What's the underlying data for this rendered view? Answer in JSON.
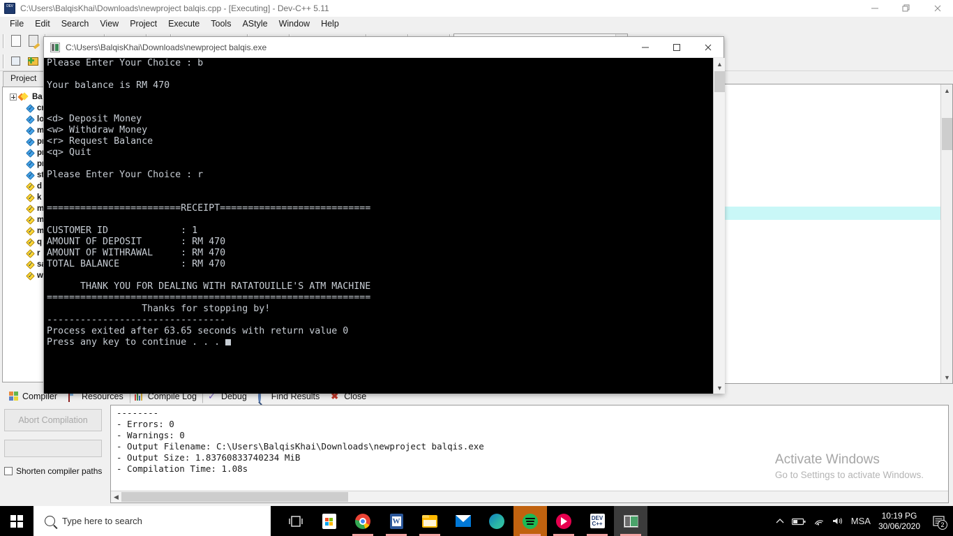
{
  "ide": {
    "title": "C:\\Users\\BalqisKhai\\Downloads\\newproject balqis.cpp - [Executing] - Dev-C++ 5.11",
    "icon": "devcpp-icon",
    "window_buttons": {
      "minimize": "–",
      "restore": "❐",
      "close": "✕"
    },
    "menu": [
      "File",
      "Edit",
      "Search",
      "View",
      "Project",
      "Execute",
      "Tools",
      "AStyle",
      "Window",
      "Help"
    ]
  },
  "project_panel": {
    "tab_label": "Project",
    "root": {
      "label": "Ba"
    },
    "items": [
      {
        "label": "cr"
      },
      {
        "label": "lo"
      },
      {
        "label": "m"
      },
      {
        "label": "pr"
      },
      {
        "label": "pr"
      },
      {
        "label": "pr"
      },
      {
        "label": "st"
      },
      {
        "label": "d"
      },
      {
        "label": "k"
      },
      {
        "label": "m"
      },
      {
        "label": "m"
      },
      {
        "label": "m"
      },
      {
        "label": "q"
      },
      {
        "label": "r"
      },
      {
        "label": "sa"
      },
      {
        "label": "w"
      }
    ]
  },
  "console": {
    "title": "C:\\Users\\BalqisKhai\\Downloads\\newproject balqis.exe",
    "icon": "console-icon",
    "window_buttons": {
      "minimize": "–",
      "maximize": "□",
      "close": "✕"
    },
    "output": "Please Enter Your Choice : b\n\nYour balance is RM 470\n\n\n<d> Deposit Money\n<w> Withdraw Money\n<r> Request Balance\n<q> Quit\n\nPlease Enter Your Choice : r\n\n\n========================RECEIPT===========================\n\nCUSTOMER ID             : 1\nAMOUNT OF DEPOSIT       : RM 470\nAMOUNT OF WITHRAWAL     : RM 470\nTOTAL BALANCE           : RM 470\n\n      THANK YOU FOR DEALING WITH RATATOUILLE'S ATM MACHINE\n==========================================================\n                 Thanks for stopping by!\n--------------------------------\nProcess exited after 63.65 seconds with return value 0\nPress any key to continue . . . ",
    "background": "#000000",
    "foreground": "#c7cdd4"
  },
  "bottom_panel": {
    "tabs": [
      {
        "label": "Compiler",
        "icon": "compiler-icon",
        "active": false
      },
      {
        "label": "Resources",
        "icon": "resources-icon",
        "active": false
      },
      {
        "label": "Compile Log",
        "icon": "compile-log-icon",
        "active": true
      },
      {
        "label": "Debug",
        "icon": "debug-icon",
        "active": false
      },
      {
        "label": "Find Results",
        "icon": "find-results-icon",
        "active": false
      },
      {
        "label": "Close",
        "icon": "close-icon",
        "active": false
      }
    ],
    "abort_button": "Abort Compilation",
    "shorten_paths_label": "Shorten compiler paths",
    "log": "--------\n- Errors: 0\n- Warnings: 0\n- Output Filename: C:\\Users\\BalqisKhai\\Downloads\\newproject balqis.exe\n- Output Size: 1.83760833740234 MiB\n- Compilation Time: 1.08s"
  },
  "watermark": {
    "title": "Activate Windows",
    "subtitle": "Go to Settings to activate Windows."
  },
  "taskbar": {
    "start_icon": "windows-start-icon",
    "search_placeholder": "Type here to search",
    "apps": [
      {
        "name": "task-view-icon"
      },
      {
        "name": "microsoft-store-icon"
      },
      {
        "name": "google-chrome-icon"
      },
      {
        "name": "microsoft-word-icon"
      },
      {
        "name": "file-explorer-icon"
      },
      {
        "name": "mail-icon"
      },
      {
        "name": "microsoft-edge-icon"
      },
      {
        "name": "spotify-icon"
      },
      {
        "name": "music-app-icon"
      },
      {
        "name": "dev-cpp-icon"
      },
      {
        "name": "console-window-icon"
      }
    ],
    "tray": {
      "chevron": "⌃",
      "battery": "battery-icon",
      "network": "network-icon",
      "volume": "volume-icon",
      "input_method": "MSA"
    },
    "clock": {
      "time": "10:19 PG",
      "date": "30/06/2020"
    },
    "notifications_count": "2"
  }
}
